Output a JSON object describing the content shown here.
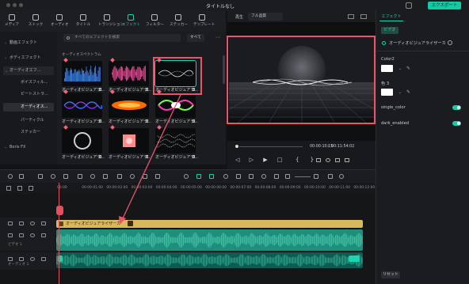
{
  "app": {
    "title": "タイトルなし",
    "export_label": "エクスポート"
  },
  "tabs": [
    {
      "label": "メディア",
      "icon": "media-icon"
    },
    {
      "label": "ストック",
      "icon": "stock-icon"
    },
    {
      "label": "オーディオ",
      "icon": "music-icon"
    },
    {
      "label": "タイトル",
      "icon": "title-icon"
    },
    {
      "label": "トランジション",
      "icon": "transition-icon"
    },
    {
      "label": "エフェクト",
      "icon": "effects-icon",
      "active": true
    },
    {
      "label": "フィルター",
      "icon": "filter-icon"
    },
    {
      "label": "ステッカー",
      "icon": "sticker-icon"
    },
    {
      "label": "テンプレート",
      "icon": "template-icon"
    }
  ],
  "categories": [
    {
      "label": "動画エフェクト",
      "level": 0
    },
    {
      "label": "ボディエフェクト",
      "level": 0
    },
    {
      "label": "オーディオエフ...",
      "level": 0,
      "open": true
    },
    {
      "label": "ボイスフィル...",
      "level": 1
    },
    {
      "label": "ビートストラ...",
      "level": 1
    },
    {
      "label": "オーディオス...",
      "level": 1,
      "selected": true
    },
    {
      "label": "パーティクル",
      "level": 1
    },
    {
      "label": "ステッカー",
      "level": 1
    },
    {
      "label": "Boris FX",
      "level": 0
    }
  ],
  "search": {
    "placeholder": "すべてのエフェクトを検索"
  },
  "filter_all": "すべて",
  "grid_section": "オーディオスペクトラム",
  "effects": [
    {
      "label": "オーディオビジュアラ...",
      "style": "blue-bars"
    },
    {
      "label": "オーディオビジュアラ...",
      "style": "pink-bars"
    },
    {
      "label": "オーディオビジュアラ...",
      "style": "white-wave",
      "highlighted": true
    },
    {
      "label": "オーディオビジュアラ...",
      "style": "blue-wave"
    },
    {
      "label": "オーディオビジュアラ...",
      "style": "orange-flame"
    },
    {
      "label": "オーディオビジュアラ...",
      "style": "green-pink-wave"
    },
    {
      "label": "オーディオビジュアラ...",
      "style": "dot-circle"
    },
    {
      "label": "オーディオビジュアラ...",
      "style": "red-square"
    },
    {
      "label": "オーディオビジュアラ...",
      "style": "dotted-lines"
    }
  ],
  "preview": {
    "player_label": "再生",
    "quality": "フル品質",
    "time_current": "00:00:10:15",
    "time_total": "00:11:54:02"
  },
  "right_panel": {
    "tab": "エフェクト",
    "subtab": "ビデオ",
    "effect_name": "オーディオビジュアライザーカ",
    "color2_label": "Color2",
    "color3_label": "色 3",
    "single_color_label": "single_color",
    "dark_enabled_label": "dark_enabled",
    "reset_label": "リセット",
    "single_color_on": true,
    "dark_enabled_on": true
  },
  "ruler_ticks": [
    "00:00",
    "00:00:01:00",
    "00:00:02:00",
    "00:00:03:00",
    "00:00:04:00",
    "00:00:05:00",
    "00:00:06:00",
    "00:00:07:00",
    "00:00:08:00",
    "00:00:09:00",
    "00:00:10:00",
    "00:00:11:00",
    "00:00:12:00"
  ],
  "timeline": {
    "effect_clip_label": "オーディオビジュアライザーカ",
    "video_track_label": "ビデオ 1",
    "audio_track_label": "オーディオ 1"
  },
  "colors": {
    "accent": "#1dd3b0",
    "highlight": "#e9546b",
    "effect_clip": "#d8b75d",
    "video_clip": "#1f8e7d"
  }
}
